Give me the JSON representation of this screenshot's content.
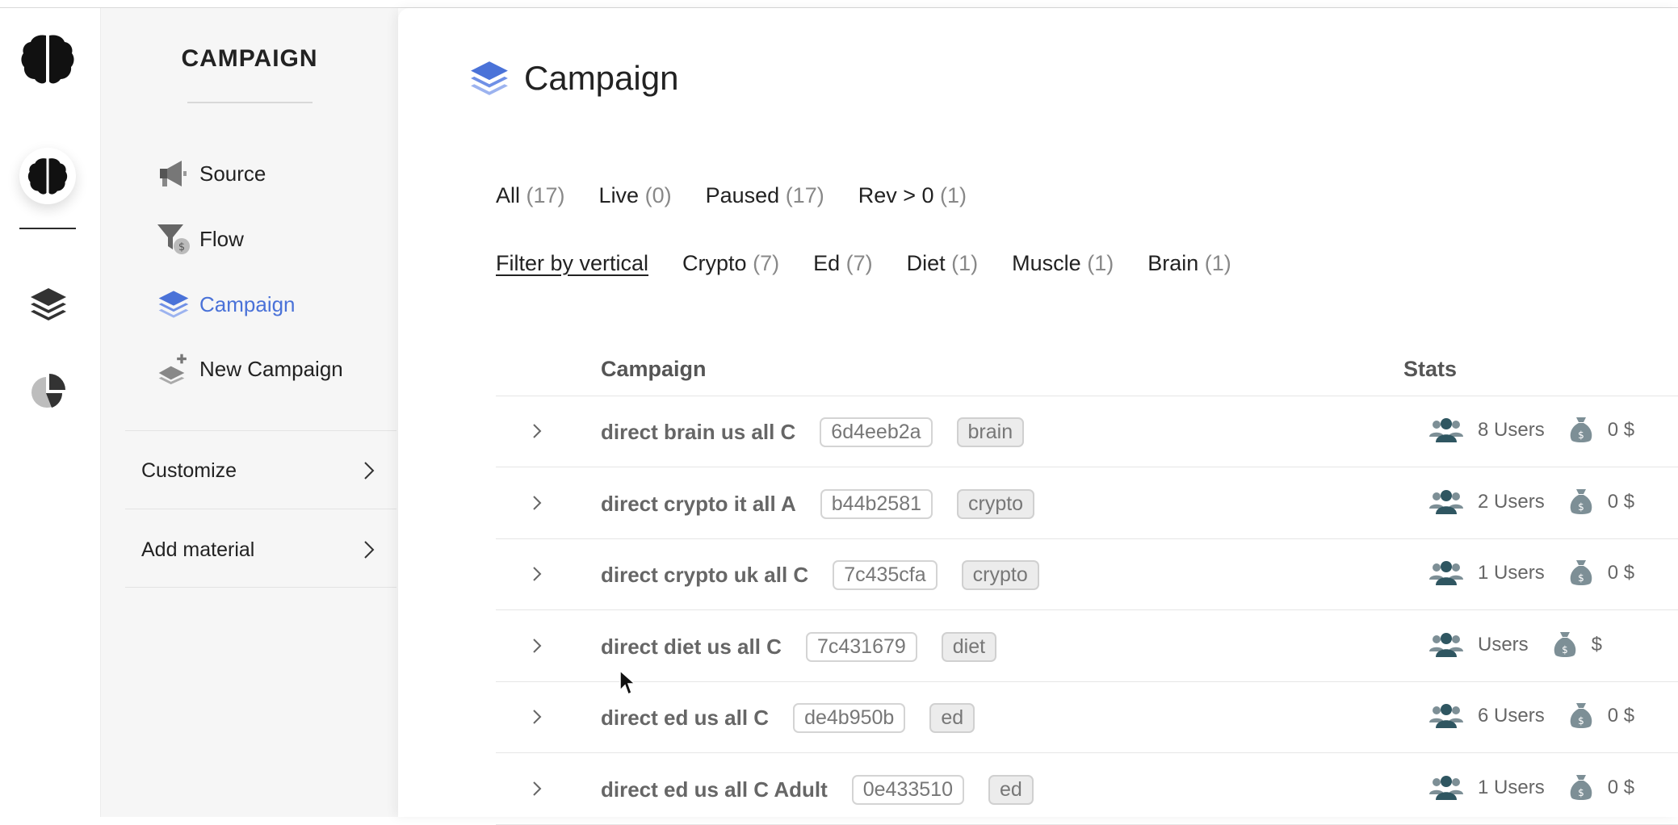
{
  "sidebar": {
    "title": "CAMPAIGN",
    "nav": [
      {
        "label": "Source",
        "icon": "megaphone-icon"
      },
      {
        "label": "Flow",
        "icon": "funnel-icon"
      },
      {
        "label": "Campaign",
        "icon": "layers-icon",
        "active": true
      },
      {
        "label": "New Campaign",
        "icon": "layers-plus-icon"
      }
    ],
    "menus": [
      {
        "label": "Customize"
      },
      {
        "label": "Add material"
      }
    ]
  },
  "main": {
    "title": "Campaign",
    "status_filters": [
      {
        "label": "All",
        "count": "(17)"
      },
      {
        "label": "Live",
        "count": "(0)"
      },
      {
        "label": "Paused",
        "count": "(17)"
      },
      {
        "label": "Rev > 0",
        "count": "(1)"
      }
    ],
    "vertical_filters": {
      "label": "Filter by vertical",
      "items": [
        {
          "label": "Crypto",
          "count": "(7)"
        },
        {
          "label": "Ed",
          "count": "(7)"
        },
        {
          "label": "Diet",
          "count": "(1)"
        },
        {
          "label": "Muscle",
          "count": "(1)"
        },
        {
          "label": "Brain",
          "count": "(1)"
        }
      ]
    },
    "table": {
      "headers": {
        "campaign": "Campaign",
        "stats": "Stats"
      },
      "rows": [
        {
          "name": "direct brain us all C",
          "id": "6d4eeb2a",
          "tag": "brain",
          "users": "8 Users",
          "money": "0 $"
        },
        {
          "name": "direct crypto it all A",
          "id": "b44b2581",
          "tag": "crypto",
          "users": "2 Users",
          "money": "0 $"
        },
        {
          "name": "direct crypto uk all C",
          "id": "7c435cfa",
          "tag": "crypto",
          "users": "1 Users",
          "money": "0 $"
        },
        {
          "name": "direct diet us all C",
          "id": "7c431679",
          "tag": "diet",
          "users": "Users",
          "money": "$"
        },
        {
          "name": "direct ed us all C",
          "id": "de4b950b",
          "tag": "ed",
          "users": "6 Users",
          "money": "0 $"
        },
        {
          "name": "direct ed us all C Adult",
          "id": "0e433510",
          "tag": "ed",
          "users": "1 Users",
          "money": "0 $"
        }
      ]
    }
  },
  "colors": {
    "accent": "#4a72d8",
    "user_icon": "#2f5661",
    "bag_icon": "#7d8f96"
  }
}
